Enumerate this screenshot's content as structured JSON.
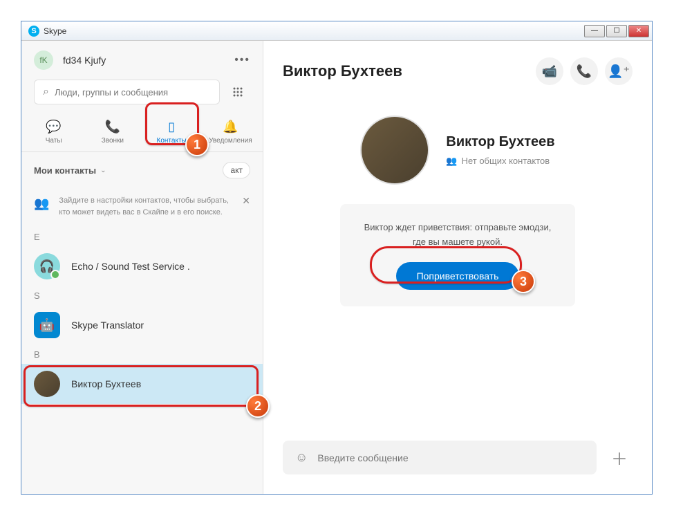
{
  "window": {
    "title": "Skype"
  },
  "profile": {
    "initials": "fK",
    "name": "fd34 Kjufy"
  },
  "search": {
    "placeholder": "Люди, группы и сообщения"
  },
  "tabs": {
    "chats": "Чаты",
    "calls": "Звонки",
    "contacts": "Контакты",
    "notifications": "Уведомления"
  },
  "section": {
    "title": "Мои контакты",
    "new_contact": "акт"
  },
  "tip": {
    "text": "Зайдите в настройки контактов, чтобы выбрать, кто может видеть вас в Скайпе и в его поиске."
  },
  "letters": {
    "e": "E",
    "s": "S",
    "v": "В"
  },
  "contacts": {
    "echo": "Echo / Sound Test Service .",
    "translator": "Skype Translator",
    "viktor": "Виктор Бухтеев"
  },
  "chat": {
    "title": "Виктор Бухтеев",
    "profile_name": "Виктор Бухтеев",
    "profile_sub": "Нет общих контактов",
    "greeting_text": "Виктор ждет приветствия: отправьте эмодзи, где вы машете рукой.",
    "greet_button": "Поприветствовать"
  },
  "composer": {
    "placeholder": "Введите сообщение"
  },
  "markers": {
    "m1": "1",
    "m2": "2",
    "m3": "3"
  }
}
